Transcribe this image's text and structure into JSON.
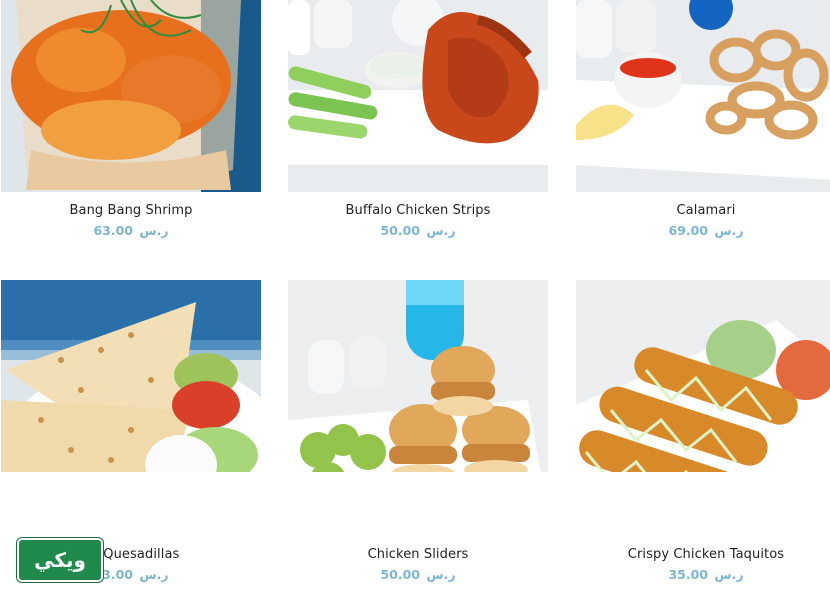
{
  "products": [
    {
      "name": "Bang Bang Shrimp",
      "price": "63.00",
      "currency": "ر.س"
    },
    {
      "name": "Buffalo Chicken Strips",
      "price": "50.00",
      "currency": "ر.س"
    },
    {
      "name": "Calamari",
      "price": "69.00",
      "currency": "ر.س"
    },
    {
      "name": "en Quesadillas",
      "price": "63.00",
      "currency": "ر.س"
    },
    {
      "name": "Chicken Sliders",
      "price": "50.00",
      "currency": "ر.س"
    },
    {
      "name": "Crispy Chicken Taquitos",
      "price": "35.00",
      "currency": "ر.س"
    }
  ],
  "watermark": {
    "text": "ويكي"
  },
  "colors": {
    "price": "#7db5d2",
    "logo_bg": "#1f8a4c"
  }
}
